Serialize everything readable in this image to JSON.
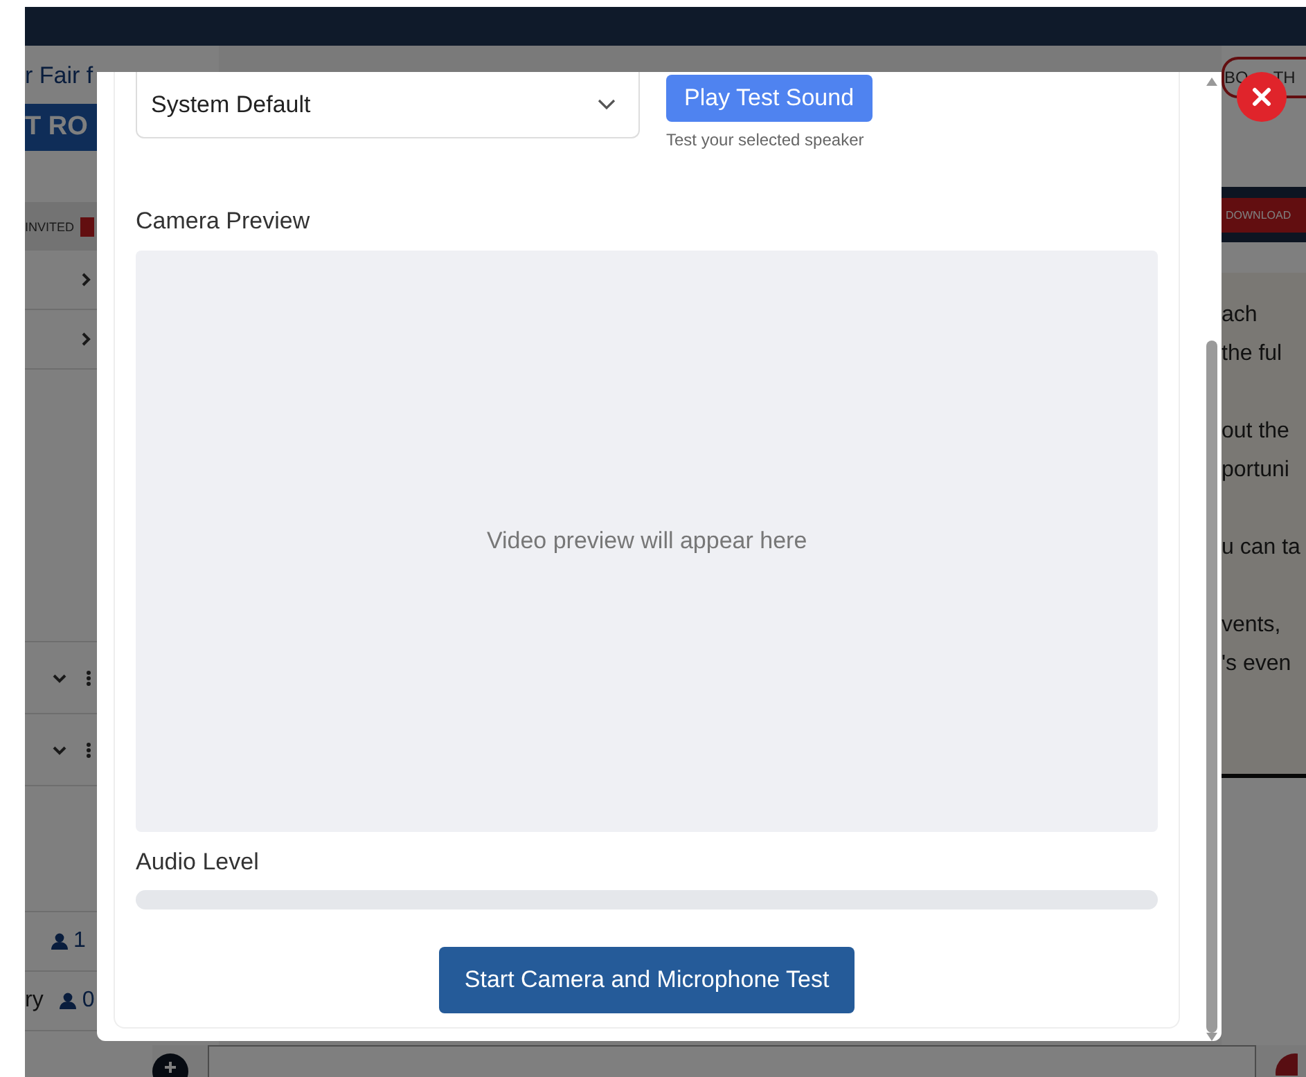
{
  "background": {
    "sidebar": {
      "title_fragment": "r Fair f",
      "room_button": "T RO",
      "invited_label": "INVITED",
      "counts": [
        {
          "count": "1"
        },
        {
          "label": "ry",
          "count": "0"
        }
      ]
    },
    "right": {
      "booth_button": [
        "BO",
        "TH"
      ],
      "download_button": "DOWNLOAD",
      "paragraphs": [
        [
          "ach",
          "the ful"
        ],
        [
          "out the",
          "portuni"
        ],
        [
          "u can ta"
        ],
        [
          "vents,",
          "'s even"
        ]
      ]
    }
  },
  "modal": {
    "speaker_select": {
      "value": "System Default"
    },
    "play_button": "Play Test Sound",
    "play_hint": "Test your selected speaker",
    "camera_label": "Camera Preview",
    "preview_placeholder": "Video preview will appear here",
    "audio_label": "Audio Level",
    "audio": {
      "level": 0
    },
    "start_button": "Start Camera and Microphone Test"
  }
}
